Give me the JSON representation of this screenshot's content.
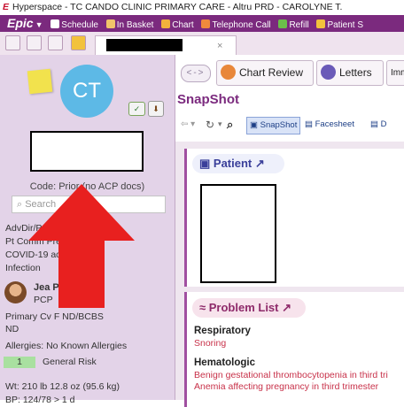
{
  "window": {
    "title": "Hyperspace - TC CANDO CLINIC PRIMARY CARE - Altru PRD - CAROLYNE T."
  },
  "menubar": {
    "epic_label": "Epic",
    "items": [
      {
        "label": "Schedule",
        "icon": "calendar-icon"
      },
      {
        "label": "In Basket",
        "icon": "inbasket-icon"
      },
      {
        "label": "Chart",
        "icon": "chart-icon"
      },
      {
        "label": "Telephone Call",
        "icon": "phone-icon"
      },
      {
        "label": "Refill",
        "icon": "refill-icon"
      },
      {
        "label": "Patient S",
        "icon": "patient-station-icon"
      }
    ]
  },
  "tabbar": {
    "close_label": "×"
  },
  "sidebar": {
    "initials": "CT",
    "code_status": "Code: Prior (no ACP docs)",
    "search_placeholder": "Search",
    "lines": {
      "advdir": "AdvDir/POA: None",
      "portal": "Pt Comm Pre    Chart",
      "covid": "COVID-19        accinated",
      "infection": "Infection",
      "pcp_name": "Jea              PA",
      "pcp_role": "PCP",
      "coverage_1": "Primary Cv              F ND/BCBS",
      "coverage_2": "ND",
      "allergies": "Allergies: No Known Allergies",
      "risk_count": "1",
      "risk_label": "General Risk",
      "weight": "Wt: 210 lb 12.8 oz (95.6 kg)",
      "bp": "BP: 124/78 > 1 d"
    }
  },
  "nav": {
    "arrows": "<->",
    "tabs": [
      {
        "label": "Chart Review",
        "icon": "chart-review-icon"
      },
      {
        "label": "Letters",
        "icon": "letters-icon"
      },
      {
        "label": "Imm"
      }
    ]
  },
  "snapshot": {
    "title": "SnapShot",
    "toolbar": {
      "snapshot_label": "SnapShot",
      "facesheet_label": "Facesheet",
      "more_label": "D"
    },
    "patient_header": "Patient",
    "problem_header": "Problem List",
    "problems": [
      {
        "category": "Respiratory",
        "items": [
          "Snoring"
        ]
      },
      {
        "category": "Hematologic",
        "items": [
          "Benign gestational thrombocytopenia in third tri",
          "Anemia affecting pregnancy in third trimester"
        ]
      }
    ]
  },
  "colors": {
    "epic_purple": "#7b2a7e",
    "sidebar_bg": "#e3d3e8",
    "avatar": "#5db9e6",
    "problem_item": "#c8324a",
    "arrow_red": "#e8201f"
  }
}
